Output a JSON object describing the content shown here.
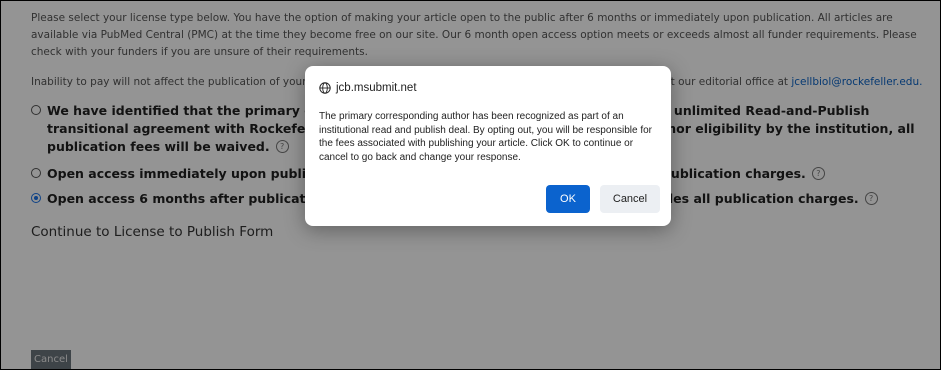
{
  "intro": {
    "paragraph": "Please select your license type below. You have the option of making your article open to the public after 6 months or immediately upon publication. All articles are available via PubMed Central (PMC) at the time they become free on our site. Our 6 month open access option meets or exceeds almost all funder requirements. Please check with your funders if you are unsure of their requirements.",
    "payment_note_before": "Inability to pay will not affect the publication of your manuscript. If you have questions about your options, please contact our editorial office at ",
    "email": "jcellbiol@rockefeller.edu."
  },
  "options": [
    {
      "label": "We have identified that the primary corresponding author is eligible to participate in an unlimited Read-and-Publish transitional agreement with Rockefeller University Press, subject to confirmation of author eligibility by the institution, all publication fees will be waived.",
      "selected": false
    },
    {
      "label": "Open access immediately upon publication under CC BY license. $5600 fee includes all publication charges.",
      "selected": false
    },
    {
      "label": "Open access 6 months after publication under CC BY-NC-SA license. $2000 flat fee includes all publication charges.",
      "selected": true
    }
  ],
  "help_glyph": "?",
  "continue_link": "Continue to License to Publish Form",
  "cancel_label": "Cancel",
  "dialog": {
    "title": "jcb.msubmit.net",
    "icon": "globe-icon",
    "message": "The primary corresponding author has been recognized as part of an institutional read and publish deal. By opting out, you will be responsible for the fees associated with publishing your article. Click OK to continue or cancel to go back and change your response.",
    "ok_label": "OK",
    "cancel_label": "Cancel"
  },
  "colors": {
    "link": "#0b63c5",
    "ok_button": "#0b63ce",
    "radio_selected": "#1a73e8",
    "cancel_page_button": "#6c757d"
  }
}
